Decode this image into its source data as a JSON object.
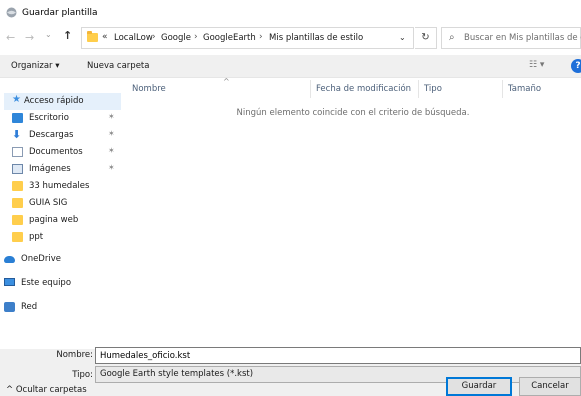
{
  "window": {
    "title": "Guardar plantilla"
  },
  "address": {
    "overflow": "«",
    "breadcrumbs": [
      "LocalLow",
      "Google",
      "GoogleEarth",
      "Mis plantillas de estilo"
    ],
    "separator": "›"
  },
  "search": {
    "placeholder": "Buscar en Mis plantillas de e..."
  },
  "toolbar": {
    "organize_label": "Organizar ▾",
    "new_folder_label": "Nueva carpeta",
    "view_label": "☷ ▾",
    "help_label": "?"
  },
  "navigation": {
    "quick_access": "Acceso rápido",
    "items": [
      {
        "label": "Escritorio",
        "icon": "desktop-icon",
        "pinned": true
      },
      {
        "label": "Descargas",
        "icon": "download-icon",
        "pinned": true
      },
      {
        "label": "Documentos",
        "icon": "documents-icon",
        "pinned": true
      },
      {
        "label": "Imágenes",
        "icon": "images-icon",
        "pinned": true
      },
      {
        "label": "33 humedales",
        "icon": "folder-icon",
        "pinned": false
      },
      {
        "label": "GUIA SIG",
        "icon": "folder-icon",
        "pinned": false
      },
      {
        "label": "pagina web",
        "icon": "folder-icon",
        "pinned": false
      },
      {
        "label": "ppt",
        "icon": "folder-icon",
        "pinned": false
      }
    ],
    "onedrive": "OneDrive",
    "this_pc": "Este equipo",
    "network": "Red"
  },
  "file_list": {
    "columns": [
      "Nombre",
      "Fecha de modificación",
      "Tipo",
      "Tamaño"
    ],
    "empty_message": "Ningún elemento coincide con el criterio de búsqueda."
  },
  "form": {
    "filename_label": "Nombre:",
    "filename_value": "Humedales_oficio.kst",
    "filetype_label": "Tipo:",
    "filetype_value": "Google Earth style templates (*.kst)"
  },
  "footer": {
    "hide_folders": "^  Ocultar carpetas",
    "save_label": "Guardar",
    "cancel_label": "Cancelar"
  },
  "colors": {
    "accent": "#0078d7",
    "selection": "#e5f0fb",
    "folder": "#ffce4c"
  }
}
